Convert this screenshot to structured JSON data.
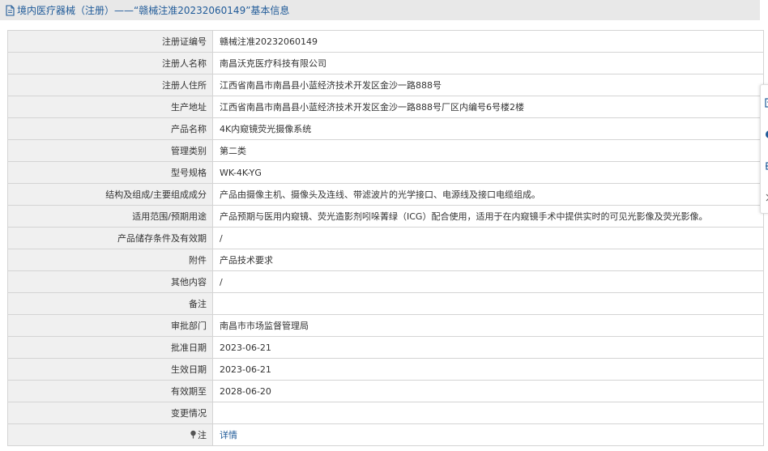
{
  "header": {
    "title": "境内医疗器械（注册）——“赣械注准20232060149”基本信息"
  },
  "rows": [
    {
      "label": "注册证编号",
      "value": "赣械注准20232060149"
    },
    {
      "label": "注册人名称",
      "value": "南昌沃克医疗科技有限公司"
    },
    {
      "label": "注册人住所",
      "value": "江西省南昌市南昌县小蓝经济技术开发区金沙一路888号"
    },
    {
      "label": "生产地址",
      "value": "江西省南昌市南昌县小蓝经济技术开发区金沙一路888号厂区内编号6号楼2楼"
    },
    {
      "label": "产品名称",
      "value": "4K内窥镜荧光摄像系统"
    },
    {
      "label": "管理类别",
      "value": "第二类"
    },
    {
      "label": "型号规格",
      "value": "WK-4K-YG"
    },
    {
      "label": "结构及组成/主要组成成分",
      "value": "产品由摄像主机、摄像头及连线、带滤波片的光学接口、电源线及接口电缆组成。"
    },
    {
      "label": "适用范围/预期用途",
      "value": "产品预期与医用内窥镜、荧光造影剂吲哚菁绿（ICG）配合使用，适用于在内窥镜手术中提供实时的可见光影像及荧光影像。"
    },
    {
      "label": "产品储存条件及有效期",
      "value": "/"
    },
    {
      "label": "附件",
      "value": "产品技术要求"
    },
    {
      "label": "其他内容",
      "value": "/"
    },
    {
      "label": "备注",
      "value": ""
    },
    {
      "label": "审批部门",
      "value": "南昌市市场监督管理局"
    },
    {
      "label": "批准日期",
      "value": "2023-06-21"
    },
    {
      "label": "生效日期",
      "value": "2023-06-21"
    },
    {
      "label": "有效期至",
      "value": "2028-06-20"
    },
    {
      "label": "变更情况",
      "value": ""
    }
  ],
  "note_row": {
    "label": "注",
    "link_text": "详情"
  },
  "colors": {
    "header_bg": "#e8e8e8",
    "title_color": "#1f5a98",
    "label_bg": "#f0f0f0",
    "border": "#d4d4d4",
    "link": "#1f5a98"
  },
  "icons": {
    "header": "document-icon",
    "note": "pin-icon",
    "sidebar": [
      "edit-icon",
      "info-icon",
      "settings-icon",
      "close-icon"
    ]
  }
}
